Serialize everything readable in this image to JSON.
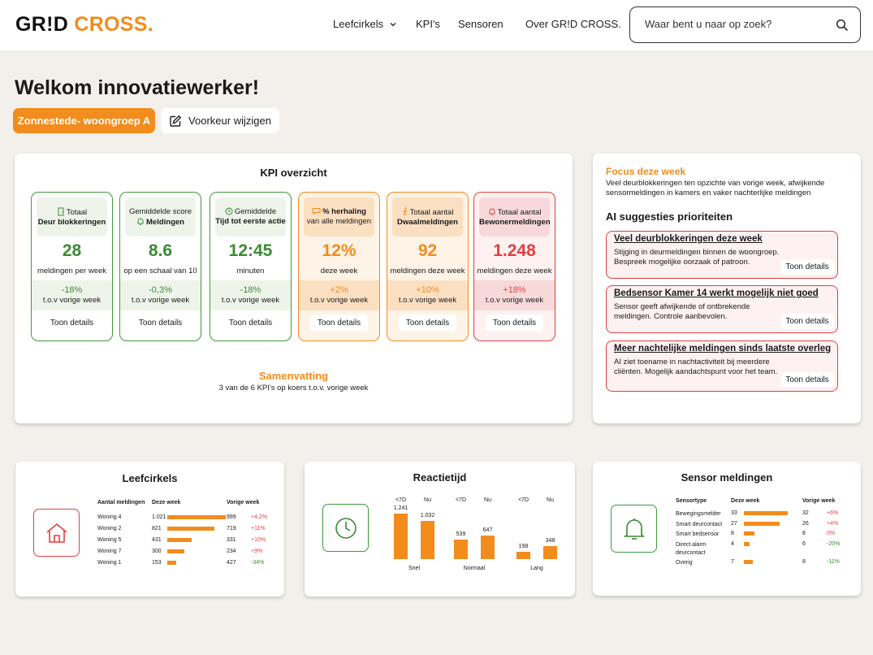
{
  "header": {
    "logo_a": "GR!D",
    "logo_b": "CROSS.",
    "nav": [
      "Leefcirkels",
      "KPI's",
      "Sensoren",
      "Over GR!D CROSS."
    ],
    "search_placeholder": "Waar bent u naar op zoek?"
  },
  "welcome": "Welkom innovatiewerker!",
  "location_button": "Zonnestede- woongroep A",
  "preference_button": "Voorkeur wijzigen",
  "kpi": {
    "title": "KPI overzicht",
    "cards": [
      {
        "line1": "Totaal",
        "line2": "Deur blokkeringen",
        "value": "28",
        "unit": "meldingen per week",
        "change": "-18%",
        "compare": "t.o.v vorige week",
        "details": "Toon details",
        "tone": "green",
        "icon": "door-icon"
      },
      {
        "line1": "Gemiddelde score",
        "line2": "Meldingen",
        "value": "8.6",
        "unit": "op een schaal van 10",
        "change": "-0,3%",
        "compare": "t.o.v vorige week",
        "details": "Toon details",
        "tone": "green",
        "icon": "bell-icon"
      },
      {
        "line1": "Gemiddelde",
        "line2": "Tijd tot eerste actie",
        "value": "12:45",
        "unit": "minuten",
        "change": "-18%",
        "compare": "t.o.v vorige week",
        "details": "Toon details",
        "tone": "green",
        "icon": "clock-icon"
      },
      {
        "line1": "% herhaling",
        "line2": "van alle meldingen",
        "value": "12%",
        "unit": "deze week",
        "change": "+2%",
        "compare": "t.o.v vorige week",
        "details": "Toon details",
        "tone": "orange",
        "icon": "chat-icon"
      },
      {
        "line1": "Totaal aantal",
        "line2": "Dwaalmeldingen",
        "value": "92",
        "unit": "meldingen deze week",
        "change": "+10%",
        "compare": "t.o.v vorige week",
        "details": "Toon details",
        "tone": "orange",
        "icon": "walker-icon"
      },
      {
        "line1": "Totaal aantal",
        "line2": "Bewonermeldingen",
        "value": "1.248",
        "unit": "meldingen deze week",
        "change": "+18%",
        "compare": "t.o.v vorige week",
        "details": "Toon details",
        "tone": "red",
        "icon": "bell-icon"
      }
    ],
    "summary_title": "Samenvatting",
    "summary_text": "3 van de 6 KPI's  op koers t.o.v. vorige week"
  },
  "focus": {
    "title": "Focus deze week",
    "text": "Veel deurblokkeringen ten opzichte van vorige week, afwijkende sensormeldingen in kamers en vaker nachterlijke meldingen",
    "ai_title": "AI suggesties prioriteiten",
    "suggestions": [
      {
        "title": "Veel deurblokkeringen deze week",
        "text": "Stijging in deurmeldingen binnen de woongroep. Bespreek mogelijke oorzaak of patroon.",
        "details": "Toon details"
      },
      {
        "title": "Bedsensor Kamer 14 werkt mogelijk niet goed",
        "text": "Sensor geeft afwijkende of ontbrekende meldingen. Controle aanbevolen.",
        "details": "Toon details"
      },
      {
        "title": "Meer nachtelijke meldingen sinds laatste overleg",
        "text": "AI ziet toename in nachtactiviteit bij meerdere cliënten. Mogelijk aandachtspunt voor het team.",
        "details": "Toon details"
      }
    ]
  },
  "leefcirkels": {
    "title": "Leefcirkels",
    "headers": [
      "Aantal meldingen",
      "Deze week",
      "Vorige week"
    ],
    "rows": [
      {
        "name": "Woning 4",
        "now": "1.021",
        "prev": "999",
        "change": "+4,2%"
      },
      {
        "name": "Woning 2",
        "now": "821",
        "prev": "719",
        "change": "+11%"
      },
      {
        "name": "Woning 5",
        "now": "431",
        "prev": "331",
        "change": "+10%"
      },
      {
        "name": "Woning 7",
        "now": "300",
        "prev": "234",
        "change": "+9%"
      },
      {
        "name": "Woning 1",
        "now": "153",
        "prev": "427",
        "change": "-34%"
      }
    ]
  },
  "chart_data": {
    "type": "bar",
    "title": "Reactietijd",
    "categories": [
      "Snel",
      "Normaal",
      "Lang"
    ],
    "series": [
      {
        "name": "<7D",
        "values": [
          1241,
          539,
          198
        ]
      },
      {
        "name": "Nu",
        "values": [
          1032,
          647,
          348
        ]
      }
    ],
    "labels": [
      "1.241",
      "1.032",
      "539",
      "647",
      "198",
      "348"
    ],
    "ylim": [
      0,
      1300
    ]
  },
  "sensor": {
    "title": "Sensor meldingen",
    "headers": [
      "Sensortype",
      "Deze week",
      "Vorige week"
    ],
    "rows": [
      {
        "name": "Bewegingsmelder",
        "now": "33",
        "prev": "32",
        "change": "+6%",
        "cls": "pos"
      },
      {
        "name": "Smart deurcontact",
        "now": "27",
        "prev": "26",
        "change": "+4%",
        "cls": "pos"
      },
      {
        "name": "Smart bedsensor",
        "now": "8",
        "prev": "8",
        "change": "0%",
        "cls": "pos"
      },
      {
        "name": "Direct alarm deurcontact",
        "now": "4",
        "prev": "6",
        "change": "-20%",
        "cls": "neg"
      },
      {
        "name": "Overig",
        "now": "7",
        "prev": "8",
        "change": "-11%",
        "cls": "neg"
      }
    ]
  }
}
